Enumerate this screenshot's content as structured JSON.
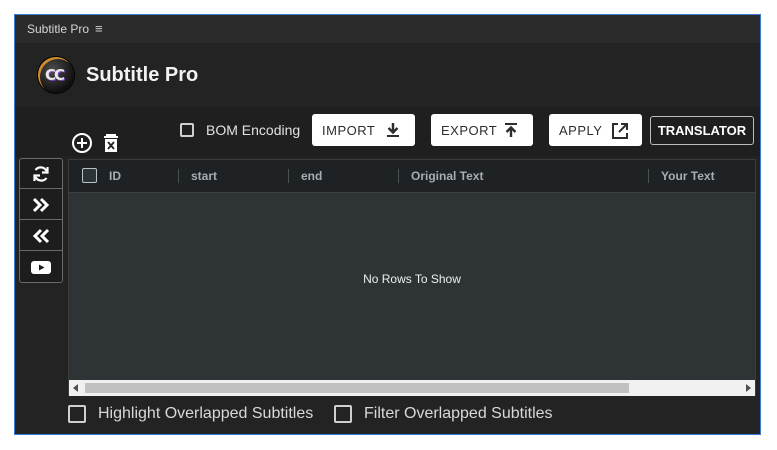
{
  "window": {
    "title": "Subtitle Pro",
    "menu_glyph": "≡"
  },
  "header": {
    "logo_text": "CC",
    "app_title": "Subtitle Pro"
  },
  "toolbar": {
    "bom_label": "BOM Encoding",
    "bom_checked": false,
    "import_label": "IMPORT",
    "export_label": "EXPORT",
    "apply_label": "APPLY",
    "translator_label": "TRANSLATOR"
  },
  "row_actions": {
    "add_icon": "add-circle-icon",
    "delete_icon": "trash-icon"
  },
  "sidebar": {
    "items": [
      {
        "icon": "sync-icon"
      },
      {
        "icon": "double-chevron-right-icon"
      },
      {
        "icon": "double-chevron-left-icon"
      },
      {
        "icon": "youtube-icon"
      }
    ]
  },
  "table": {
    "columns": [
      "ID",
      "start",
      "end",
      "Original Text",
      "Your Text"
    ],
    "empty_text": "No Rows To Show",
    "rows": []
  },
  "footer": {
    "highlight_label": "Highlight Overlapped Subtitles",
    "filter_label": "Filter Overlapped Subtitles"
  },
  "colors": {
    "panel_bg": "#232323",
    "grid_bg": "#2e3436",
    "border_accent": "#3a7bd5"
  }
}
